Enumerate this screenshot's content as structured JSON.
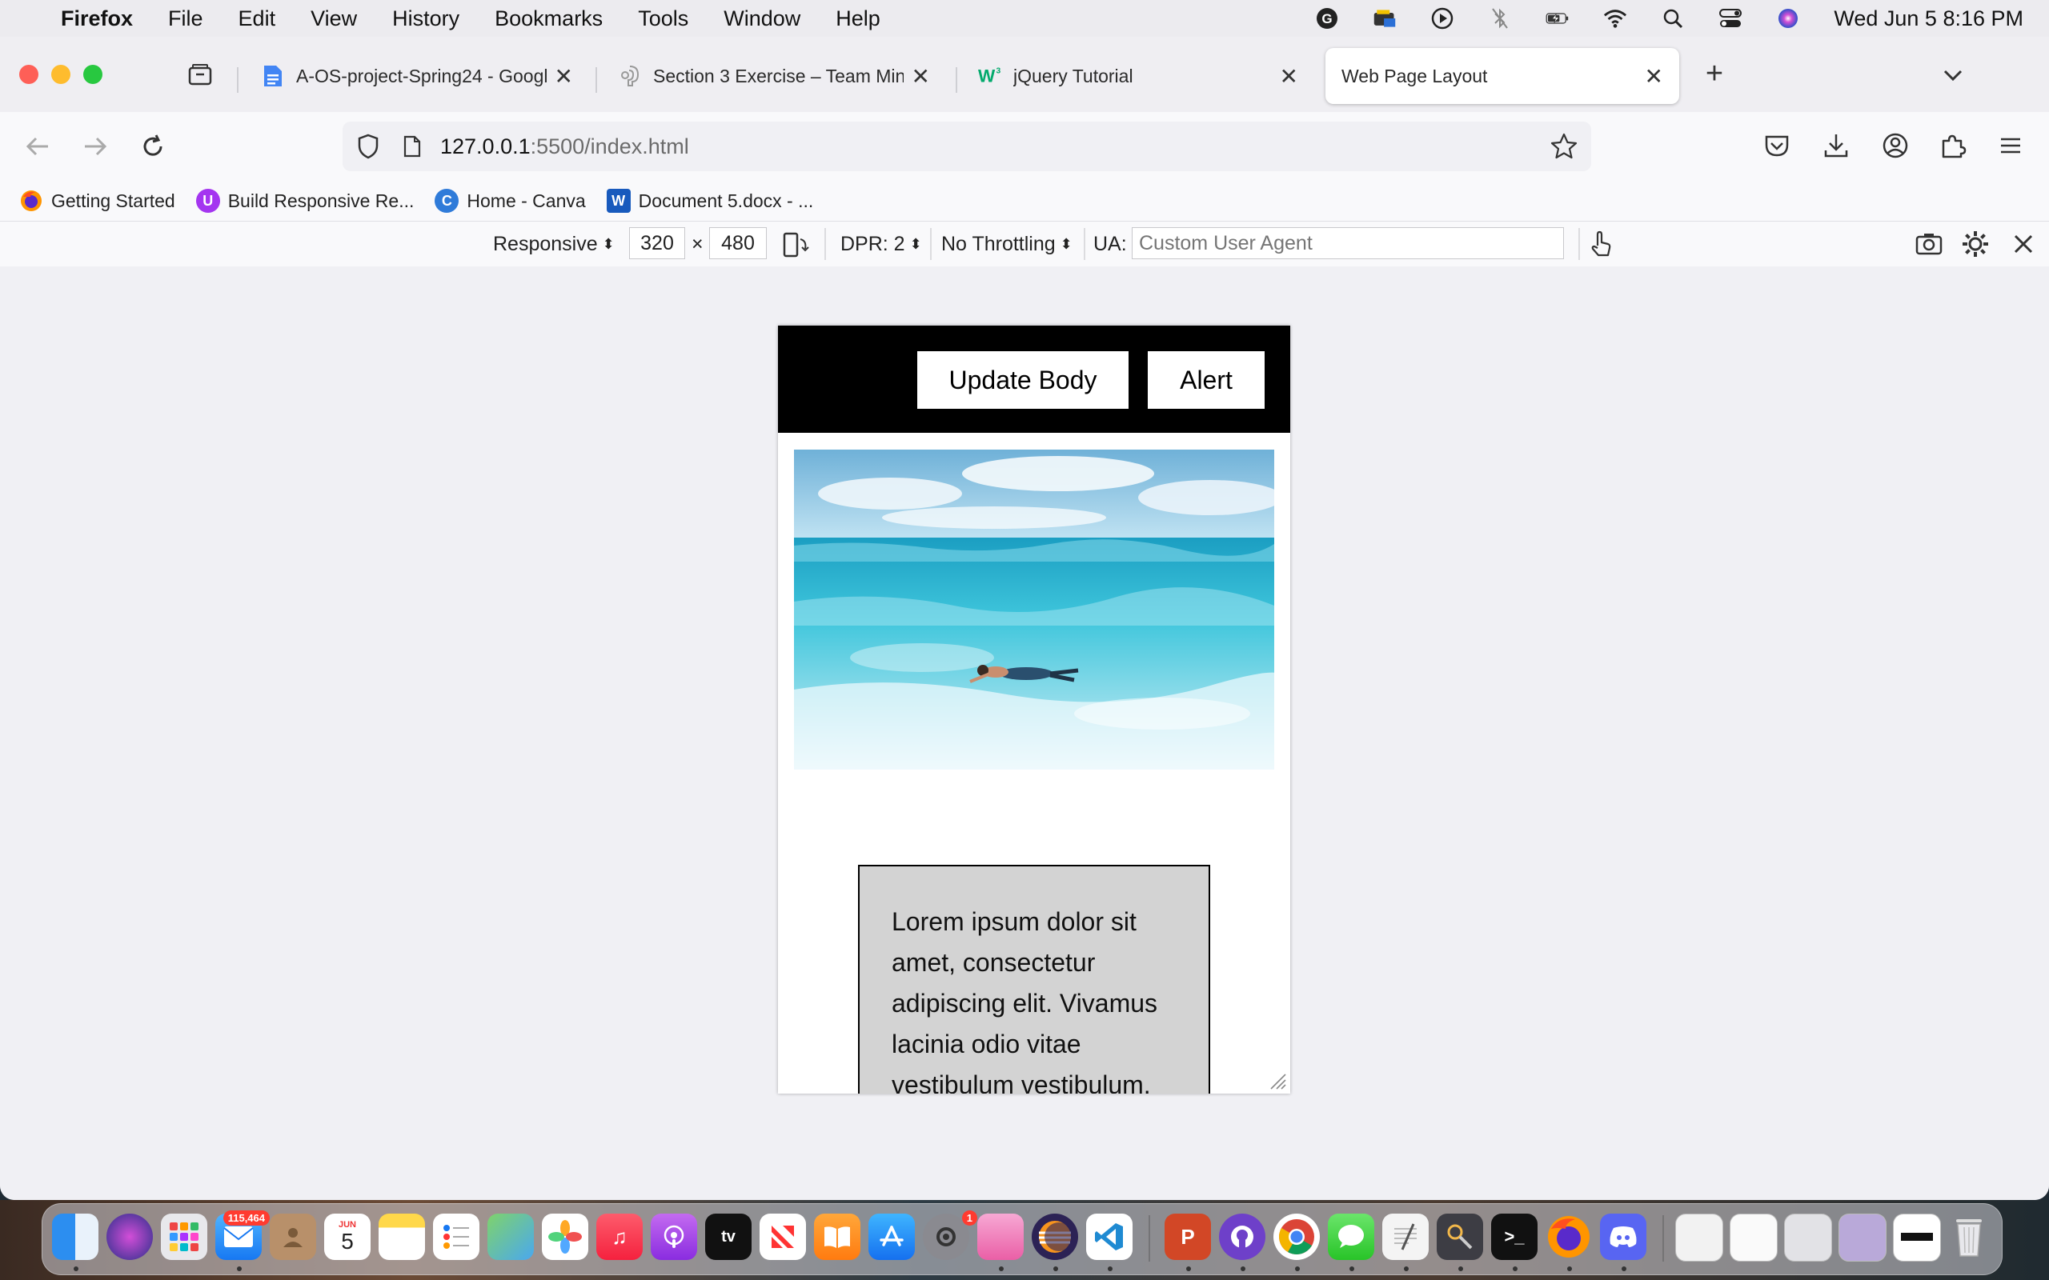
{
  "menubar": {
    "app_name": "Firefox",
    "items": [
      "File",
      "Edit",
      "View",
      "History",
      "Bookmarks",
      "Tools",
      "Window",
      "Help"
    ],
    "clock": "Wed Jun 5  8:16 PM"
  },
  "tabs": [
    {
      "title": "A-OS-project-Spring24 - Googl",
      "icon": "google-docs-icon"
    },
    {
      "title": "Section 3 Exercise – Team MindS",
      "icon": "notion-icon"
    },
    {
      "title": "jQuery Tutorial",
      "icon": "w3schools-icon"
    },
    {
      "title": "Web Page Layout",
      "icon": "none",
      "active": true
    }
  ],
  "urlbar": {
    "host": "127.0.0.1",
    "path": ":5500/index.html"
  },
  "bookmarks": [
    {
      "label": "Getting Started",
      "icon": "firefox-icon",
      "color": "#e66000"
    },
    {
      "label": "Build Responsive Re...",
      "icon": "udemy-icon",
      "color": "#a435f0"
    },
    {
      "label": "Home - Canva",
      "icon": "canva-icon",
      "color": "#2f7bd9"
    },
    {
      "label": "Document 5.docx - ...",
      "icon": "word-icon",
      "color": "#185abd"
    }
  ],
  "rdm": {
    "device": "Responsive",
    "width": "320",
    "times": "×",
    "height": "480",
    "dpr": "DPR: 2",
    "throttling": "No Throttling",
    "ua_label": "UA:",
    "ua_placeholder": "Custom User Agent"
  },
  "page": {
    "buttons": {
      "update": "Update Body",
      "alert": "Alert"
    },
    "hero_alt": "swimmer-in-ocean",
    "paragraph": "Lorem ipsum dolor sit amet, consectetur adipiscing elit. Vivamus lacinia odio vitae vestibulum vestibulum."
  },
  "dock": {
    "mail_badge": "115,464",
    "calendar_month": "JUN",
    "calendar_day": "5",
    "settings_badge": "1"
  },
  "colors": {
    "page_header": "#000000",
    "textbox_bg": "#d3d3d3",
    "active_tab": "#ffffff"
  }
}
